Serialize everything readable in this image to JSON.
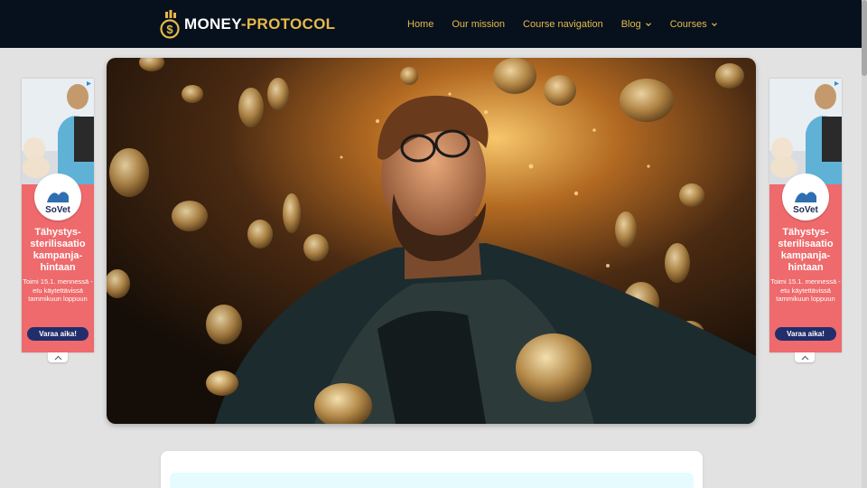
{
  "brand": {
    "logo_word1": "MONEY",
    "logo_dash": "-",
    "logo_word2": "PROTOCOL",
    "accent": "#e8b84a",
    "header_bg": "#06111d"
  },
  "nav": {
    "items": [
      {
        "label": "Home",
        "has_dropdown": false
      },
      {
        "label": "Our mission",
        "has_dropdown": false
      },
      {
        "label": "Course navigation",
        "has_dropdown": false
      },
      {
        "label": "Blog",
        "has_dropdown": true
      },
      {
        "label": "Courses",
        "has_dropdown": true
      }
    ]
  },
  "hero": {
    "image": "man-with-glasses-surrounded-by-falling-gold-coins"
  },
  "ads": {
    "brand": "SoVet",
    "headline": "Tähystys-sterilisaatio kampanja-hintaan",
    "body": "Toimi 15.1. mennessä - etu käytettävissä tammikuun loppuun",
    "cta": "Varaa aika!",
    "bg_color": "#ee6a6c",
    "cta_color": "#222e6b"
  }
}
